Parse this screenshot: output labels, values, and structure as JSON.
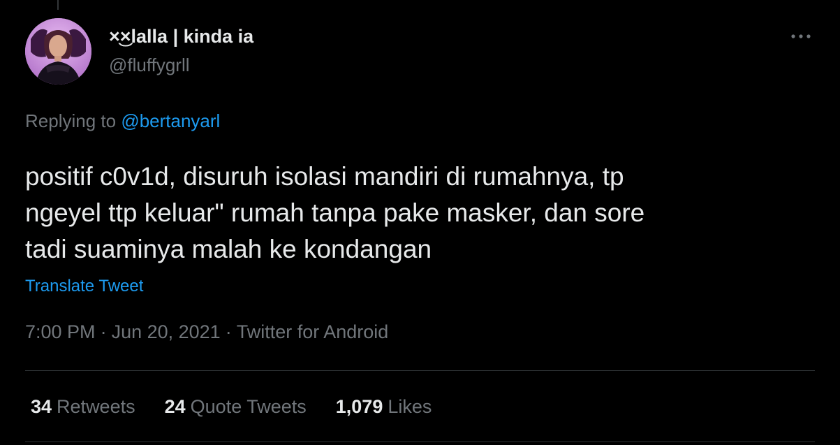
{
  "author": {
    "display_name": "×͜×lalla | kinda ia",
    "handle": "@fluffygrll"
  },
  "reply": {
    "prefix": "Replying to",
    "mention": "@bertanyarl"
  },
  "tweet": {
    "line1": "positif c0v1d, disuruh isolasi mandiri di rumahnya, tp",
    "line2": "ngeyel ttp keluar\" rumah tanpa pake masker, dan sore",
    "line3": "tadi suaminya malah ke kondangan",
    "translate_label": "Translate Tweet"
  },
  "meta": {
    "time": "7:00 PM",
    "date": "Jun 20, 2021",
    "source": "Twitter for Android",
    "separator": "·"
  },
  "stats": {
    "retweets": {
      "count": "34",
      "label": "Retweets"
    },
    "quotes": {
      "count": "24",
      "label": "Quote Tweets"
    },
    "likes": {
      "count": "1,079",
      "label": "Likes"
    }
  },
  "icons": {
    "more": "more-horizontal-icon",
    "avatar": "user-avatar"
  },
  "colors": {
    "background": "#000000",
    "text": "#e7e9ea",
    "secondary": "#71767b",
    "link": "#1d9bf0",
    "divider": "#2f3336"
  }
}
